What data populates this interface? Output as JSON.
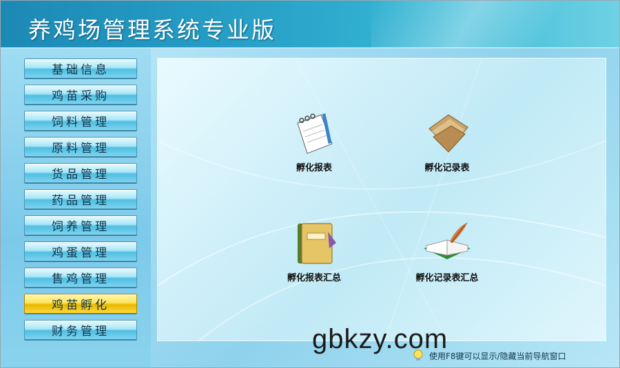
{
  "header": {
    "title": "养鸡场管理系统专业版"
  },
  "sidebar": {
    "items": [
      {
        "label": "基础信息",
        "active": false
      },
      {
        "label": "鸡苗采购",
        "active": false
      },
      {
        "label": "饲料管理",
        "active": false
      },
      {
        "label": "原料管理",
        "active": false
      },
      {
        "label": "货品管理",
        "active": false
      },
      {
        "label": "药品管理",
        "active": false
      },
      {
        "label": "饲养管理",
        "active": false
      },
      {
        "label": "鸡蛋管理",
        "active": false
      },
      {
        "label": "售鸡管理",
        "active": false
      },
      {
        "label": "鸡苗孵化",
        "active": true
      },
      {
        "label": "财务管理",
        "active": false
      }
    ]
  },
  "panel": {
    "features": [
      {
        "label": "孵化报表",
        "icon": "notepad-icon"
      },
      {
        "label": "孵化记录表",
        "icon": "folder-icon"
      },
      {
        "label": "孵化报表汇总",
        "icon": "notebook-icon"
      },
      {
        "label": "孵化记录表汇总",
        "icon": "open-book-quill-icon"
      }
    ]
  },
  "watermark": {
    "text": "gbkzy.com"
  },
  "status": {
    "hint": "使用F8键可以显示/隐藏当前导航窗口"
  },
  "colors": {
    "active_nav": "#ffd93a",
    "header": "#2aa3c9",
    "nav": "#7fd3ee"
  }
}
